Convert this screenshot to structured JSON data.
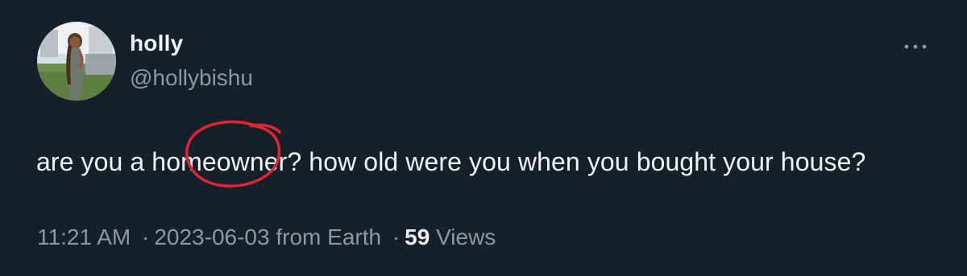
{
  "tweet": {
    "author_name": "holly",
    "author_handle": "@hollybishu",
    "more_icon": "more-horizontal-icon",
    "text": "are you a homeowner? how old were you when you bought your house?",
    "time": "11:21 AM",
    "separator": "·",
    "date": "2023-06-03",
    "source": "from Earth",
    "views_count": "59",
    "views_label": "Views"
  },
  "colors": {
    "background": "#16202b",
    "primary_text": "#e7e9ea",
    "secondary_text": "#8b98a5",
    "annotation_red": "#e2242f"
  }
}
